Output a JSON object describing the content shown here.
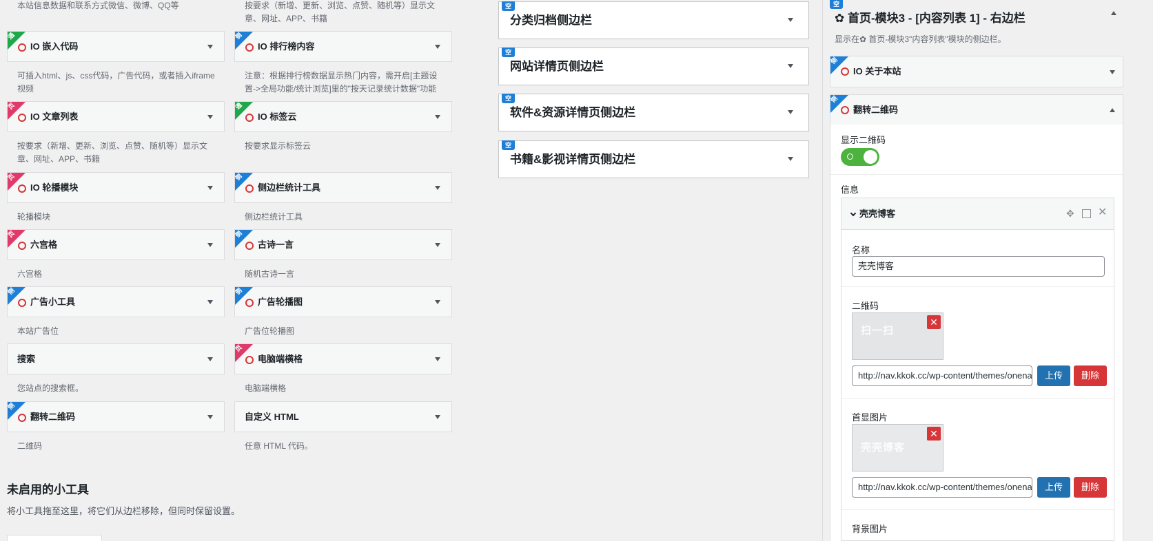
{
  "left_top_descs": {
    "col1": "本站信息数据和联系方式微信、微博、QQ等",
    "col2": "按要求（新增、更新、浏览、点赞、随机等）显示文章、网址、APP、书籍"
  },
  "widgets": [
    {
      "title": "IO 嵌入代码",
      "desc": "可插入html、js、css代码，广告代码，或者插入iframe 视频",
      "ribbon": "通",
      "ribbon_color": "#1ea84a"
    },
    {
      "title": "IO 排行榜内容",
      "desc": "注意：根据排行榜数据显示热门内容，需开启[主题设置->全局功能/统计浏览]里的\"按天记录统计数据\"功能",
      "ribbon": "侧",
      "ribbon_color": "#1e7fd6"
    },
    {
      "title": "IO 文章列表",
      "desc": "按要求（新增、更新、浏览、点赞、随机等）显示文章、网址、APP、书籍",
      "ribbon": "页",
      "ribbon_color": "#e03a6a"
    },
    {
      "title": "IO 标签云",
      "desc": "按要求显示标签云",
      "ribbon": "通",
      "ribbon_color": "#1ea84a"
    },
    {
      "title": "IO 轮播模块",
      "desc": "轮播模块",
      "ribbon": "页",
      "ribbon_color": "#e03a6a"
    },
    {
      "title": "侧边栏统计工具",
      "desc": "侧边栏统计工具",
      "ribbon": "侧",
      "ribbon_color": "#1e7fd6"
    },
    {
      "title": "六宫格",
      "desc": "六宫格",
      "ribbon": "页",
      "ribbon_color": "#e03a6a"
    },
    {
      "title": "古诗一言",
      "desc": "随机古诗一言",
      "ribbon": "侧",
      "ribbon_color": "#1e7fd6"
    },
    {
      "title": "广告小工具",
      "desc": "本站广告位",
      "ribbon": "侧",
      "ribbon_color": "#1e7fd6"
    },
    {
      "title": "广告轮播图",
      "desc": "广告位轮播图",
      "ribbon": "侧",
      "ribbon_color": "#1e7fd6"
    },
    {
      "title": "搜索",
      "desc": "您站点的搜索框。",
      "ribbon": "",
      "ribbon_color": ""
    },
    {
      "title": "电脑端横格",
      "desc": "电脑端横格",
      "ribbon": "页",
      "ribbon_color": "#e03a6a"
    },
    {
      "title": "翻转二维码",
      "desc": "二维码",
      "ribbon": "侧",
      "ribbon_color": "#1e7fd6"
    },
    {
      "title": "自定义 HTML",
      "desc": "任意 HTML 代码。",
      "ribbon": "",
      "ribbon_color": ""
    }
  ],
  "sidebars": [
    {
      "title": "分类归档侧边栏",
      "tag": "空"
    },
    {
      "title": "网站详情页侧边栏",
      "tag": "空"
    },
    {
      "title": "软件&资源详情页侧边栏",
      "tag": "空"
    },
    {
      "title": "书籍&影视详情页侧边栏",
      "tag": "空"
    }
  ],
  "right_panel": {
    "tag": "空",
    "title": "✿ 首页-模块3 - [内容列表 1] - 右边栏",
    "desc": "显示在✿ 首页-模块3\"内容列表\"模块的侧边栏。",
    "widget1": {
      "title": "IO 关于本站",
      "ribbon": "侧"
    },
    "widget2": {
      "title": "翻转二维码",
      "ribbon": "侧"
    },
    "form": {
      "show_qr_label": "显示二维码",
      "info_label": "信息",
      "group_title": "壳壳博客",
      "name_label": "名称",
      "name_value": "壳壳博客",
      "qr_label": "二维码",
      "qr_thumb_text": "扫一扫",
      "qr_url": "http://nav.kkok.cc/wp-content/themes/onenav",
      "upload_label": "上传",
      "delete_label": "删除",
      "first_img_label": "首显图片",
      "first_thumb_text": "壳壳博客",
      "first_url": "http://nav.kkok.cc/wp-content/themes/onenav",
      "bg_img_label": "背景图片"
    }
  },
  "unused": {
    "title": "未启用的小工具",
    "desc": "将小工具拖至这里，将它们从边栏移除，但同时保留设置。"
  }
}
